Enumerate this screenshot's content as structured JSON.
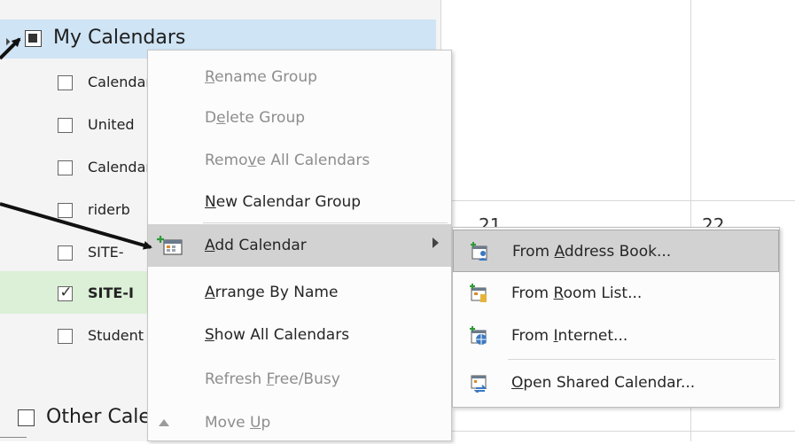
{
  "folder_pane": {
    "group_name": "My Calendars",
    "calendars": [
      {
        "label": "Calendar",
        "checked": false,
        "bold": false
      },
      {
        "label": "United",
        "checked": false,
        "bold": false
      },
      {
        "label": "Calendar",
        "checked": false,
        "bold": false
      },
      {
        "label": "riderb",
        "checked": false,
        "bold": false
      },
      {
        "label": "SITE-",
        "checked": false,
        "bold": false
      },
      {
        "label": "SITE-I",
        "checked": true,
        "bold": true
      },
      {
        "label": "Student",
        "checked": false,
        "bold": false
      }
    ],
    "other_group_name": "Other Calendars"
  },
  "calendar_grid": {
    "day_numbers": [
      "21",
      "22"
    ]
  },
  "context_menu": {
    "items": [
      {
        "pre": "",
        "key": "R",
        "post": "ename Group",
        "enabled": false
      },
      {
        "pre": "D",
        "key": "e",
        "post": "lete Group",
        "enabled": false
      },
      {
        "pre": "Remo",
        "key": "v",
        "post": "e All Calendars",
        "enabled": false
      },
      {
        "pre": "",
        "key": "N",
        "post": "ew Calendar Group",
        "enabled": true
      },
      {
        "pre": "",
        "key": "A",
        "post": "dd Calendar",
        "enabled": true,
        "submenu": true
      },
      {
        "pre": "",
        "key": "A",
        "post": "rrange By Name",
        "enabled": true
      },
      {
        "pre": "",
        "key": "S",
        "post": "how All Calendars",
        "enabled": true
      },
      {
        "pre": "Refresh ",
        "key": "F",
        "post": "ree/Busy",
        "enabled": false
      },
      {
        "pre": "Move ",
        "key": "U",
        "post": "p",
        "enabled": false
      }
    ]
  },
  "add_calendar_submenu": {
    "items": [
      {
        "pre": "From ",
        "key": "A",
        "post": "ddress Book...",
        "icon": "address-book-icon"
      },
      {
        "pre": "From ",
        "key": "R",
        "post": "oom List...",
        "icon": "room-list-icon"
      },
      {
        "pre": "From ",
        "key": "I",
        "post": "nternet...",
        "icon": "internet-calendar-icon"
      },
      {
        "pre": "",
        "key": "O",
        "post": "pen Shared Calendar...",
        "icon": "shared-calendar-icon"
      }
    ]
  },
  "colors": {
    "group_header_bg": "#cfe4f5",
    "selected_row_bg": "#dcefd7",
    "menu_hover_bg": "#d2d2d2",
    "disabled_text": "#8d8d8d"
  }
}
